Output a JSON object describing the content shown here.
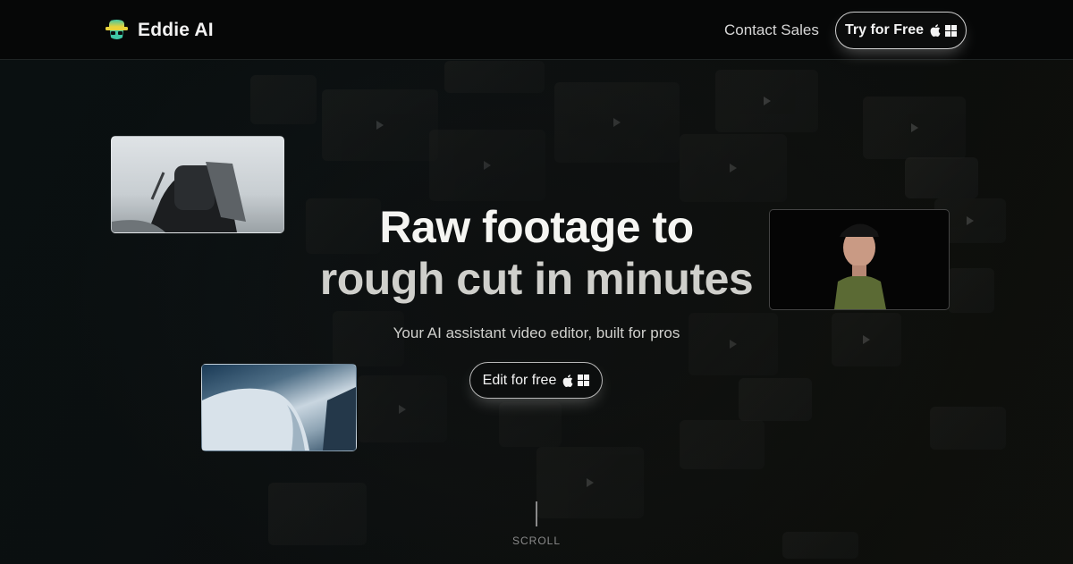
{
  "header": {
    "brand": "Eddie AI",
    "contact_label": "Contact Sales",
    "try_label": "Try for Free"
  },
  "hero": {
    "title_line1": "Raw footage to",
    "title_line2": "rough cut in minutes",
    "subtitle": "Your AI assistant video editor, built for pros",
    "cta_label": "Edit for free"
  },
  "scroll": {
    "label": "SCROLL"
  },
  "icons": [
    "logo-mark-icon",
    "apple-icon",
    "windows-icon"
  ],
  "colors": {
    "header_bg": "#060707",
    "button_border": "#cfcfcf",
    "logo_teal": "#3fc7a6",
    "logo_yellow": "#e8d23a"
  }
}
